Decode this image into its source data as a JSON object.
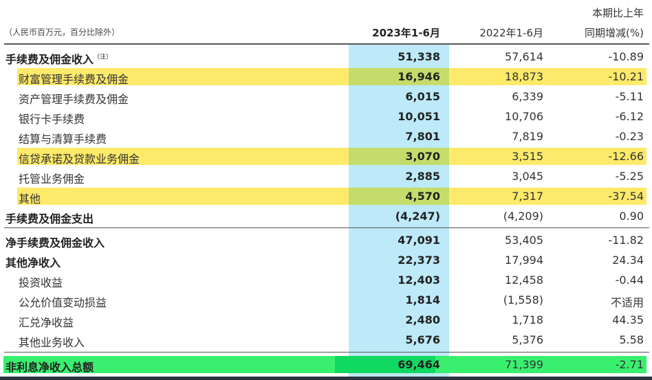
{
  "header": {
    "unit": "（人民币百万元，百分比除外）",
    "col1": "2023年1-6月",
    "col2": "2022年1-6月",
    "col3_line1": "本期比上年",
    "col3_line2": "同期增减(%)"
  },
  "colors": {
    "highlight_yellow": "#fdea6a",
    "highlight_green": "#39f06e",
    "column_blue": "#bde9f8"
  },
  "rows": [
    {
      "label": "手续费及佣金收入",
      "note": "（注）",
      "v2023": "51,338",
      "v2022": "57,614",
      "change": "-10.89",
      "level": 0
    },
    {
      "label": "财富管理手续费及佣金",
      "v2023": "16,946",
      "v2022": "18,873",
      "change": "-10.21",
      "level": 1,
      "highlight": "yellow"
    },
    {
      "label": "资产管理手续费及佣金",
      "v2023": "6,015",
      "v2022": "6,339",
      "change": "-5.11",
      "level": 1
    },
    {
      "label": "银行卡手续费",
      "v2023": "10,051",
      "v2022": "10,706",
      "change": "-6.12",
      "level": 1
    },
    {
      "label": "结算与清算手续费",
      "v2023": "7,801",
      "v2022": "7,819",
      "change": "-0.23",
      "level": 1
    },
    {
      "label": "信贷承诺及贷款业务佣金",
      "v2023": "3,070",
      "v2022": "3,515",
      "change": "-12.66",
      "level": 1,
      "highlight": "yellow"
    },
    {
      "label": "托管业务佣金",
      "v2023": "2,885",
      "v2022": "3,045",
      "change": "-5.25",
      "level": 1
    },
    {
      "label": "其他",
      "v2023": "4,570",
      "v2022": "7,317",
      "change": "-37.54",
      "level": 1,
      "highlight": "yellow"
    },
    {
      "label": "手续费及佣金支出",
      "v2023": "(4,247)",
      "v2022": "(4,209)",
      "change": "0.90",
      "level": 0
    },
    {
      "label": "净手续费及佣金收入",
      "v2023": "47,091",
      "v2022": "53,405",
      "change": "-11.82",
      "level": 0
    },
    {
      "label": "其他净收入",
      "v2023": "22,373",
      "v2022": "17,994",
      "change": "24.34",
      "level": 0
    },
    {
      "label": "投资收益",
      "v2023": "12,403",
      "v2022": "12,458",
      "change": "-0.44",
      "level": 1
    },
    {
      "label": "公允价值变动损益",
      "v2023": "1,814",
      "v2022": "(1,558)",
      "change": "不适用",
      "level": 1
    },
    {
      "label": "汇兑净收益",
      "v2023": "2,480",
      "v2022": "1,718",
      "change": "44.35",
      "level": 1
    },
    {
      "label": "其他业务收入",
      "v2023": "5,676",
      "v2022": "5,376",
      "change": "5.58",
      "level": 1
    },
    {
      "label": "非利息净收入总额",
      "v2023": "69,464",
      "v2022": "71,399",
      "change": "-2.71",
      "level": 0,
      "highlight": "green"
    }
  ]
}
